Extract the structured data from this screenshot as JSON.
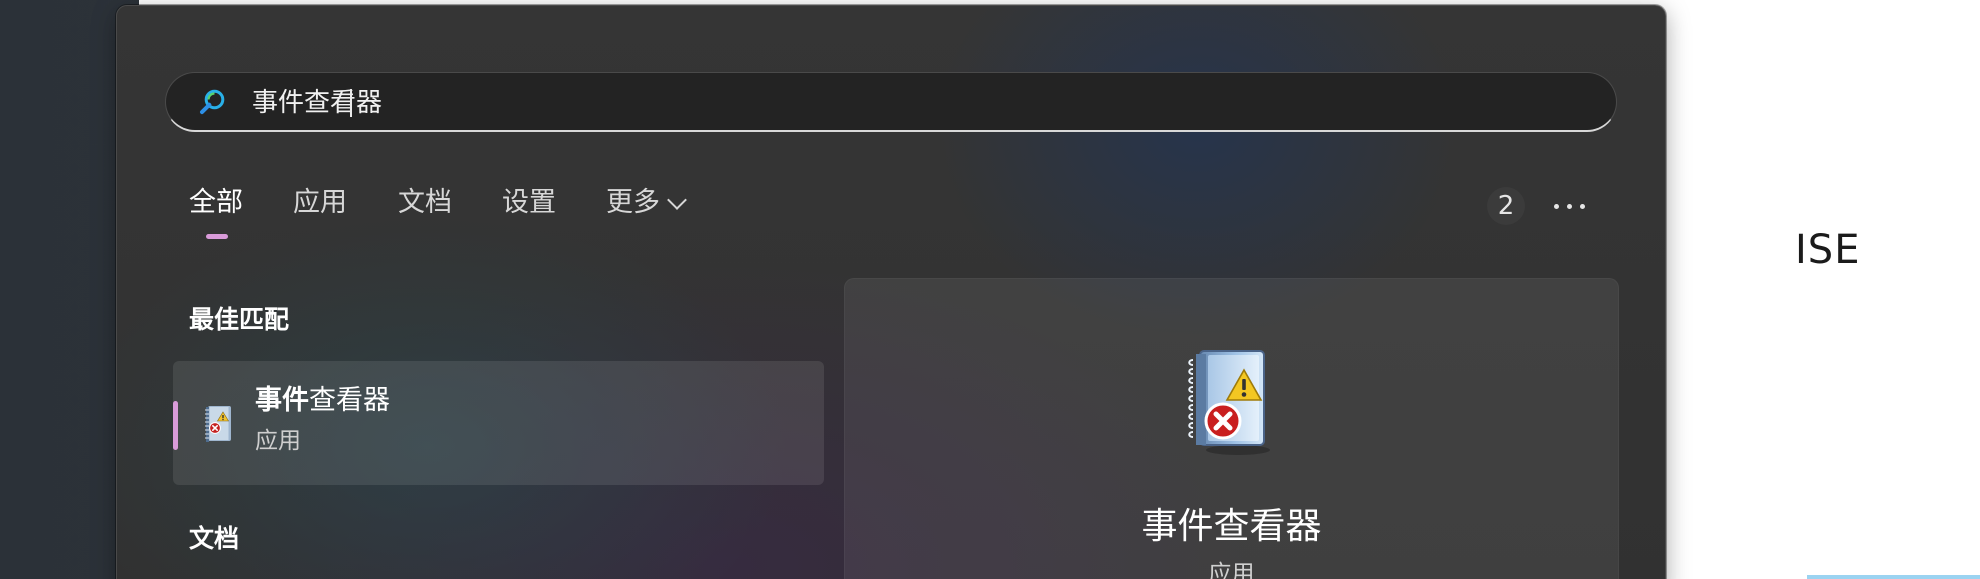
{
  "background_window": {
    "visible_text": "ISE"
  },
  "search": {
    "query": "事件查看器",
    "icon": "search-icon"
  },
  "tabs": [
    {
      "label": "全部",
      "selected": true
    },
    {
      "label": "应用"
    },
    {
      "label": "文档"
    },
    {
      "label": "设置"
    },
    {
      "label": "更多",
      "icon": "chevron-down-icon"
    }
  ],
  "result_count": "2",
  "more_options_icon": "more-options-icon",
  "best_match": {
    "section_title": "最佳匹配",
    "item": {
      "title_highlight": "事件",
      "title_rest": "查看器",
      "subtitle": "应用",
      "icon": "event-viewer-icon"
    }
  },
  "documents": {
    "section_title": "文档"
  },
  "details": {
    "title": "事件查看器",
    "subtitle": "应用",
    "icon": "event-viewer-icon"
  },
  "colors": {
    "accent": "#d99bd9",
    "flyout_background": "#333333",
    "search_box": "#232323"
  }
}
